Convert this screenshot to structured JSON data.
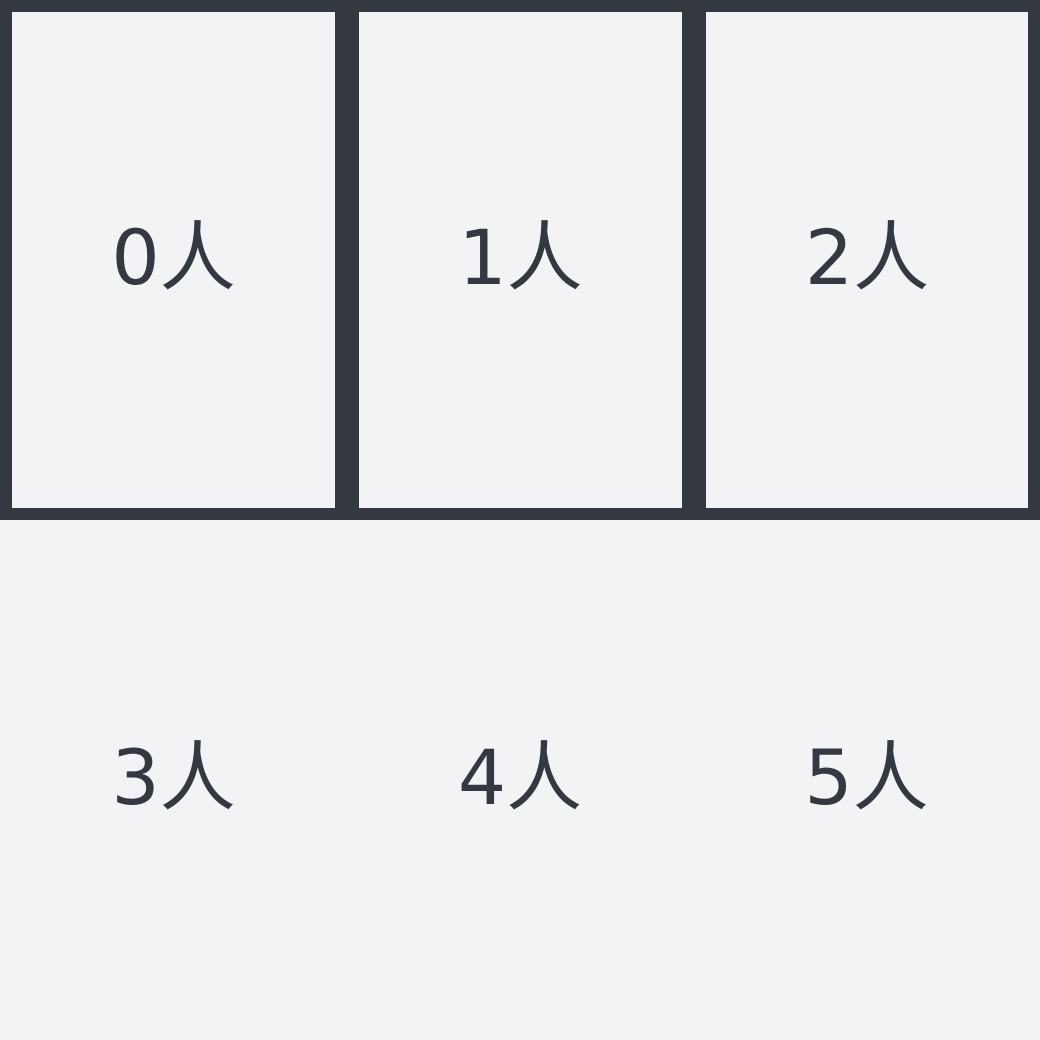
{
  "grid": {
    "cells": [
      {
        "label": "0人",
        "selected": true
      },
      {
        "label": "1人",
        "selected": true
      },
      {
        "label": "2人",
        "selected": true
      },
      {
        "label": "3人",
        "selected": false
      },
      {
        "label": "4人",
        "selected": false
      },
      {
        "label": "5人",
        "selected": false
      }
    ]
  },
  "colors": {
    "background": "#f2f3f5",
    "frame": "#343941",
    "text": "#343941"
  }
}
